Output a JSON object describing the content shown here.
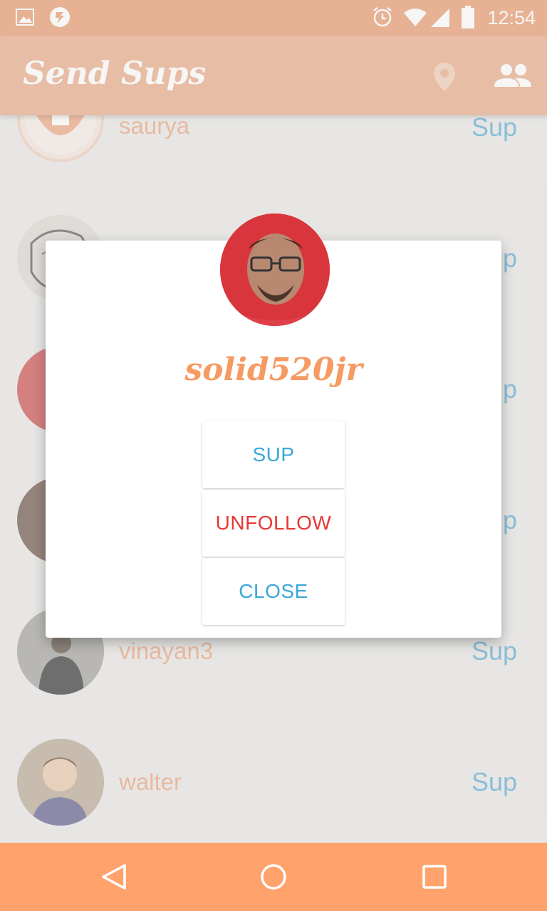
{
  "status_bar": {
    "time": "12:54",
    "icons": [
      "image-icon",
      "app-notification-icon",
      "alarm-icon",
      "wifi-icon",
      "signal-icon",
      "battery-icon"
    ]
  },
  "app_bar": {
    "title": "Send Sups",
    "actions": [
      "location-icon",
      "people-icon"
    ]
  },
  "list": {
    "rows": [
      {
        "username": "saurya",
        "action": "Sup"
      },
      {
        "username": "",
        "action": "Sup"
      },
      {
        "username": "",
        "action": "Sup"
      },
      {
        "username": "",
        "action": "Sup"
      },
      {
        "username": "vinayan3",
        "action": "Sup"
      },
      {
        "username": "walter",
        "action": "Sup"
      }
    ]
  },
  "dialog": {
    "username": "solid520jr",
    "buttons": {
      "sup": "SUP",
      "unfollow": "UNFOLLOW",
      "close": "CLOSE"
    }
  },
  "colors": {
    "status_bar": "#e8956a",
    "app_bar": "#e9a886",
    "username": "#eaa17e",
    "sup_link": "#5aa9d4",
    "dialog_name": "#f59b62",
    "unfollow": "#e53935",
    "nav_bar": "#ffa26c"
  },
  "nav_bar": {
    "buttons": [
      "back-icon",
      "home-icon",
      "recents-icon"
    ]
  }
}
